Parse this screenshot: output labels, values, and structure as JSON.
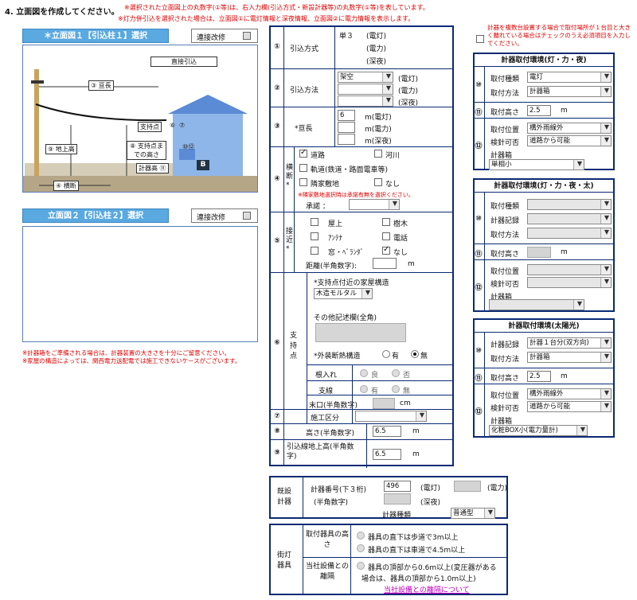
{
  "section_title": "4. 立面図を作成してください。",
  "notes_top": [
    "※選択された立面図上の丸数字(①等)は、右入力欄(引込方式・新設計器等)の丸数字(①等)を表しています。",
    "※灯力併引込を選択された場合は、立面図①に電灯情報と深夜情報、立面図②に電力情報を表示します。"
  ],
  "elev1": {
    "button": "＊立面図１【引込柱１】選択",
    "link_label": "連接改修"
  },
  "elev2": {
    "button": "立面図２【引込柱２】選択",
    "link_label": "連接改修"
  },
  "diagram": {
    "direct": "直接引込",
    "span": "③ 亘長",
    "support_pt": "支持点",
    "n6": "⑥",
    "n7": "⑦",
    "ground": "⑨ 地上高",
    "sup_height": "⑧ 支持点までの高さ",
    "n10": "⑩⑫",
    "meter_h": "計器高 ⑪",
    "b": "B",
    "yoko": "④ 横断"
  },
  "notes_left": [
    "※計器箱をご準備される場合は、計器装置の大きさを十分にご留意ください。",
    "※家屋の構造によっては、関西電力送配電では施工できないケースがございます。"
  ],
  "form": {
    "r1": {
      "num": "①",
      "label": "引込方式",
      "v1": "単３",
      "s1": "(電灯)",
      "s2": "(電力)",
      "s3": "(深夜)"
    },
    "r2": {
      "num": "②",
      "label": "引込方法",
      "v1": "架空",
      "s1": "(電灯)",
      "s2": "(電力)",
      "s3": "(深夜)"
    },
    "r3": {
      "num": "③",
      "label": "*亘長",
      "v1": "6",
      "s1": "m(電灯)",
      "s2": "m(電力)",
      "s3": "m(深夜)"
    },
    "r4": {
      "num": "④",
      "label": "横断*",
      "o1": "道路",
      "o2": "河川",
      "o3": "軌道(鉄道・路面電車等)",
      "o4": "隣家敷地",
      "o5": "なし",
      "note": "※隣家敷地選択時は承諾有無を選択ください。",
      "approval": "承諾 ："
    },
    "r5": {
      "num": "⑤",
      "label": "接近*",
      "o1": "屋上",
      "o2": "樹木",
      "o3": "ｱﾝﾃﾅ",
      "o4": "電話",
      "o5": "窓・ﾍﾞﾗﾝﾀﾞ",
      "o6": "なし",
      "dist": "距離(半角数字):",
      "unit": "m"
    },
    "r6": {
      "num": "⑥",
      "label": "支持点",
      "struct_label": "*支持点付近の家屋構造",
      "struct_val": "木造モルタル",
      "other_label": "その他記述欄(全角)",
      "outer_label": "*外装断熱構造",
      "yes": "有",
      "no": "無",
      "nejire": "根入れ",
      "good": "良",
      "bad": "否",
      "shisen": "支線",
      "y2": "有",
      "n2": "無",
      "suekuchi": "末口(半角数字)",
      "cm": "cm"
    },
    "r7": {
      "num": "⑦",
      "label": "施工区分"
    },
    "r8": {
      "num": "⑧",
      "label": "高さ(半角数字)",
      "val": "6.5",
      "unit": "m"
    },
    "r9": {
      "num": "⑨",
      "label": "引込線地上高(半角数字)",
      "val": "6.5",
      "unit": "m"
    }
  },
  "right": {
    "check_note": "計器を複数台設置する場合で取付場所が１台目と大きく離れている場合はチェックのうえ必須項目を入力してください。",
    "p1": {
      "title": "計器取付環境(灯・力・夜)",
      "n10": "⑩",
      "type_l": "取付種類",
      "type_v": "電灯",
      "meth_l": "取付方法",
      "meth_v": "計器箱",
      "n11": "⑪",
      "h_l": "取付高さ",
      "h_v": "2.5",
      "m": "m",
      "n12": "⑫",
      "pos_l": "取付位置",
      "pos_v": "構外雨線外",
      "chk_l": "検針可否",
      "chk_v": "道路から可能",
      "box_l": "計器箱",
      "box_v": "単相小"
    },
    "p2": {
      "title": "計器取付環境(灯・力・夜・太)",
      "n10": "⑩",
      "type_l": "取付種類",
      "rec_l": "計器記録",
      "meth_l": "取付方法",
      "n11": "⑪",
      "h_l": "取付高さ",
      "m": "m",
      "n12": "⑫",
      "pos_l": "取付位置",
      "chk_l": "検針可否",
      "box_l": "計器箱"
    },
    "p3": {
      "title": "計器取付環境(太陽光)",
      "n10": "⑩",
      "rec_l": "計器記録",
      "rec_v": "計器１台分(双方向)",
      "meth_l": "取付方法",
      "meth_v": "計器箱",
      "n11": "⑪",
      "h_l": "取付高さ",
      "h_v": "2.5",
      "m": "m",
      "n12": "⑫",
      "pos_l": "取付位置",
      "pos_v": "構外雨線外",
      "chk_l": "検針可否",
      "chk_v": "道路から可能",
      "box_l": "計器箱",
      "box_v": "化粧BOX小(電力量計)"
    }
  },
  "existing": {
    "label": "既設計器",
    "num_l": "計器番号(下３桁)",
    "num_sub": "(半角数字)",
    "v1": "496",
    "s1": "(電灯)",
    "s2": "(電力)",
    "s3": "(深夜)",
    "type_l": "計器種類",
    "type_v": "普通型"
  },
  "street": {
    "label": "街灯器具",
    "h_l": "取付器具の高さ",
    "h1": "器具の直下は歩道で3m以上",
    "h2": "器具の直下は車道で4.5m以上",
    "d_l": "当社設備との離隔",
    "d1": "器具の頂部から0.6m以上(変圧器がある",
    "d2": "場合は、器具の頂部から1.0m以上)",
    "link": "当社設備との離隔について"
  }
}
